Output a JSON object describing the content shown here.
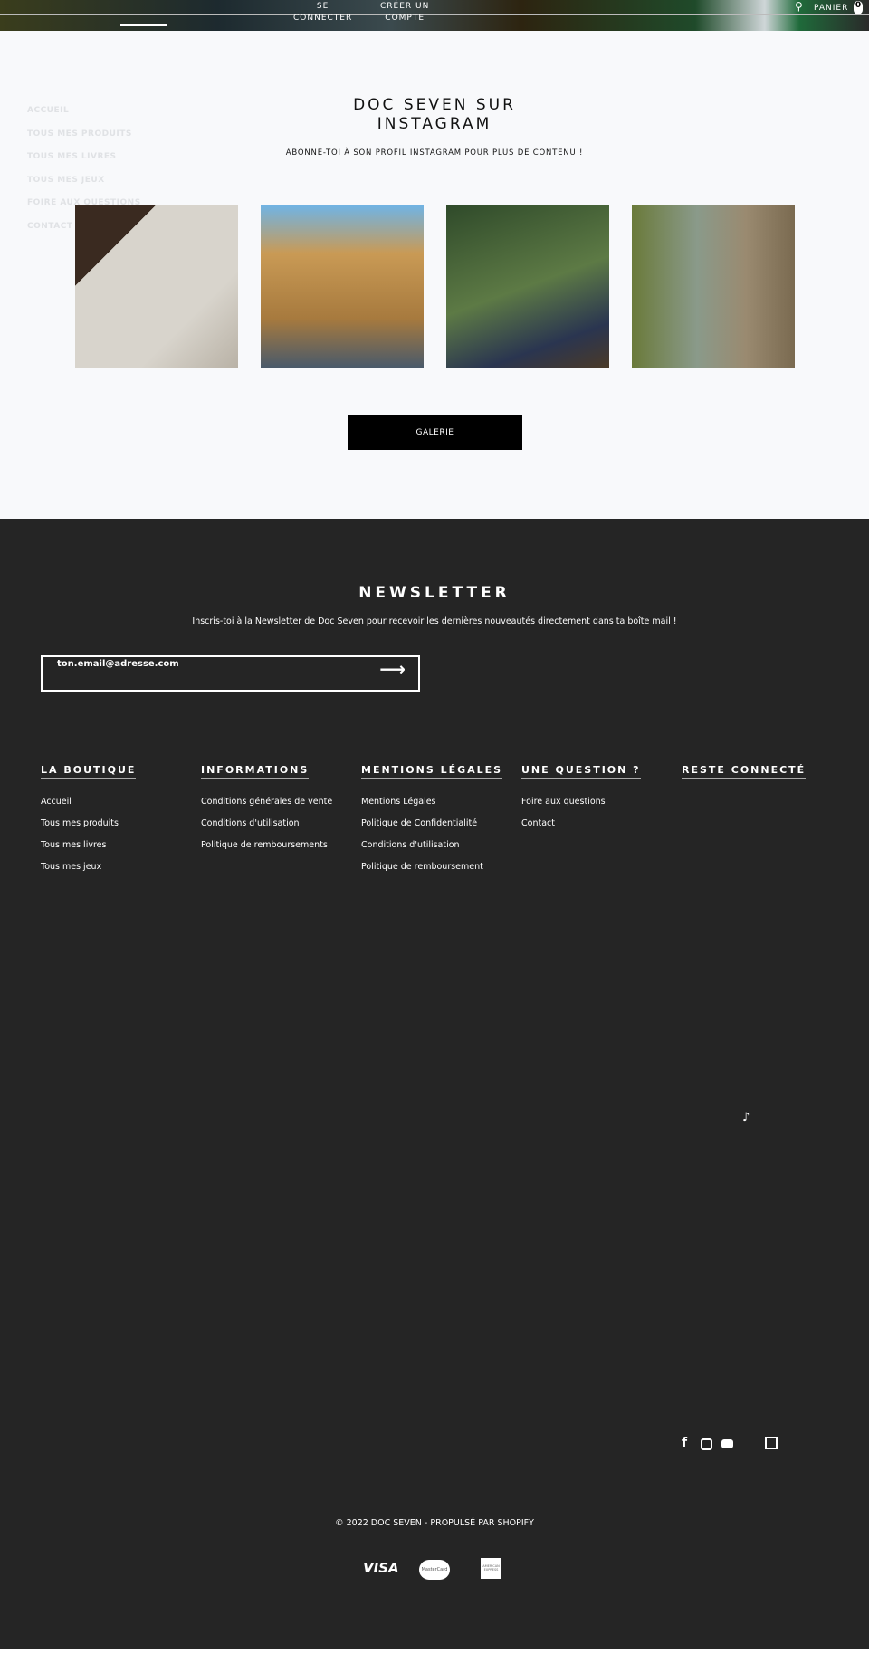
{
  "header": {
    "login": "SE CONNECTER",
    "login_l1": "SE",
    "login_l2": "CONNECTER",
    "register_l1": "CRÉER UN",
    "register_l2": "COMPTE",
    "cart_label": "PANIER",
    "cart_count": "0"
  },
  "side_menu": [
    "ACCUEIL",
    "TOUS MES PRODUITS",
    "TOUS MES LIVRES",
    "TOUS MES JEUX",
    "FOIRE AUX QUESTIONS",
    "CONTACT"
  ],
  "instagram": {
    "title_l1": "DOC SEVEN SUR",
    "title_l2": "INSTAGRAM",
    "subtitle": "ABONNE-TOI À SON PROFIL INSTAGRAM POUR PLUS DE CONTENU !",
    "button": "GALERIE"
  },
  "newsletter": {
    "title": "NEWSLETTER",
    "subtitle": "Inscris-toi à la Newsletter de Doc Seven pour recevoir les dernières nouveautés directement dans ta boîte mail !",
    "placeholder": "ton.email@adresse.com"
  },
  "footer": {
    "columns": [
      {
        "title": "LA BOUTIQUE",
        "links": [
          "Accueil",
          "Tous mes produits",
          "Tous mes livres",
          "Tous mes jeux"
        ]
      },
      {
        "title": "INFORMATIONS",
        "links": [
          "Conditions générales de vente",
          "Conditions d'utilisation",
          "Politique de remboursements"
        ]
      },
      {
        "title": "MENTIONS LÉGALES",
        "links": [
          "Mentions Légales",
          "Politique de Confidentialité",
          "Conditions d'utilisation",
          "Politique de remboursement"
        ]
      },
      {
        "title": "UNE QUESTION ?",
        "links": [
          "Foire aux questions",
          "Contact"
        ]
      },
      {
        "title": "RESTE CONNECTÉ",
        "links": []
      }
    ],
    "social": [
      "tiktok-icon",
      "facebook-icon",
      "instagram-icon",
      "youtube-icon",
      "twitch-icon"
    ],
    "copyright": "© 2022 DOC SEVEN - PROPULSÉ PAR SHOPIFY",
    "payments": {
      "visa": "VISA",
      "mastercard": "MasterCard",
      "amex": "AMERICAN EXPRESS"
    }
  }
}
